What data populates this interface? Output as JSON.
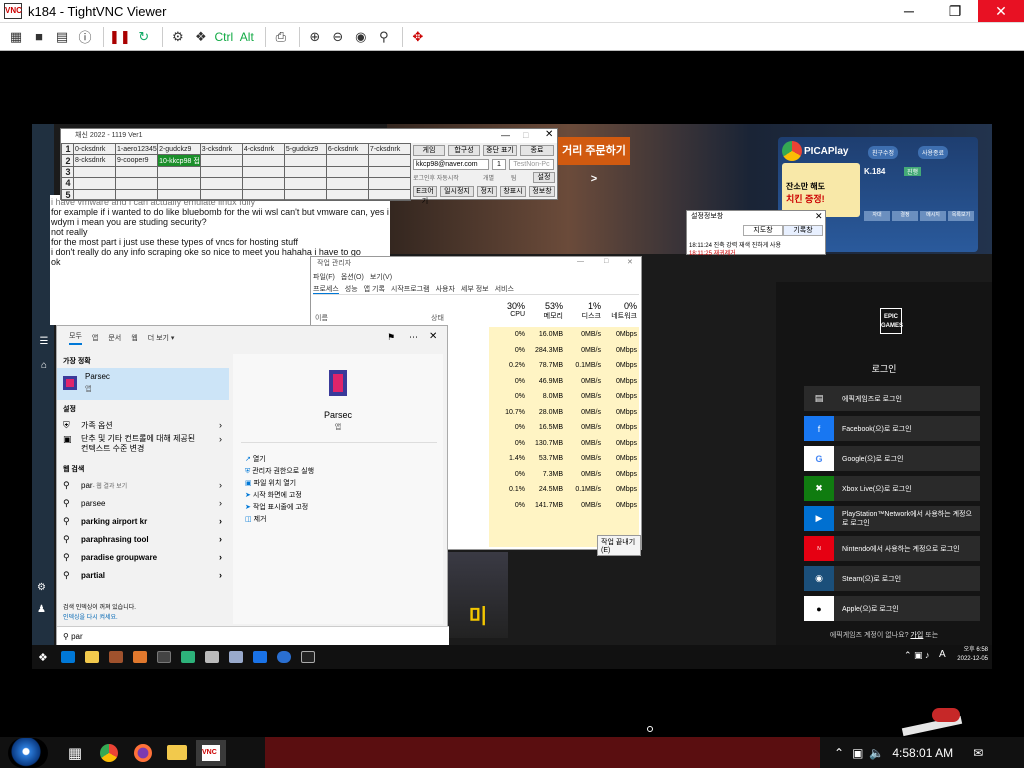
{
  "window": {
    "title": "k184 - TightVNC Viewer",
    "icon": "VNC",
    "controls": [
      "minimize-icon",
      "maximize-icon",
      "close-icon"
    ]
  },
  "toolbar": {
    "ctrl": "Ctrl",
    "alt": "Alt"
  },
  "remote": {
    "game_window": {
      "title": "채신 2022 - 1119 Ver1",
      "rows": [
        "1",
        "2",
        "3",
        "4",
        "5"
      ],
      "row1": [
        "0-cksdnrk",
        "1-aero12345",
        "2-gudckz9",
        "3-cksdnrk",
        "4-cksdnrk",
        "5-gudckz9",
        "6-cksdnrk",
        "7-cksdnrk"
      ],
      "row2": [
        "8-cksdnrk",
        "9-cooper9",
        "10-kkcp98"
      ],
      "row2_sub": "접",
      "buttons": [
        "게임",
        "합구성",
        "중단 표기",
        "종료"
      ],
      "email": "kkcp98@naver.com",
      "pass": "1",
      "mode": "TestNon-Pc",
      "check1": "로그인후 자동시작",
      "check2": "개별",
      "check3": "팀",
      "set": "설정",
      "bottom_buttons": [
        "E크어기",
        "일시정지",
        "정지",
        "창표시",
        "정보창"
      ]
    },
    "chat": [
      "i have vmware and i can actually emulate linux fully",
      "for example if i wanted to do like bluebomb for the wii wsl can't but vmware can, yes i",
      "wdym i mean you are studing security?",
      "not really",
      "for the most part i just use these types of vncs for hosting stuff",
      "i don't really do any info scraping oke so nice to meet you hahaha i have to go",
      "ok"
    ],
    "banner": "거리 주문하기 >",
    "picaplay": {
      "brand": "PICAPlay",
      "btn1": "친구수정",
      "btn2": "사용종료",
      "id": "K.184",
      "status": "진행",
      "promo1": "잔소만 해도",
      "promo2": "치킨 증정!",
      "tabs": [
        "자대",
        "결정",
        "메시지",
        "목록보기"
      ]
    },
    "dialog": {
      "title": "설정정보창",
      "tab1": "지도창",
      "tab2": "기록창",
      "line1": "18:11:24 진축 강력 재색 진하게 사용",
      "line2": "18:11:25 재귀제거"
    },
    "taskmgr": {
      "title": "작업 관리자",
      "menu": [
        "파일(F)",
        "옵션(O)",
        "보기(V)"
      ],
      "tabs": [
        "프로세스",
        "성능",
        "앱 기록",
        "시작프로그램",
        "사용자",
        "세부 정보",
        "서비스"
      ],
      "col_name": "이름",
      "col_status": "상태",
      "cpu_pct": "30%",
      "cpu": "CPU",
      "mem_pct": "53%",
      "mem": "메모리",
      "disk_pct": "1%",
      "disk": "디스크",
      "net_pct": "0%",
      "net": "네트워크",
      "cpu_vals": [
        "0%",
        "0%",
        "0.2%",
        "0%",
        "0%",
        "10.7%",
        "0%",
        "0%",
        "1.4%",
        "0%",
        "0.1%",
        "0%"
      ],
      "mem_vals": [
        "16.0MB",
        "284.3MB",
        "78.7MB",
        "46.9MB",
        "8.0MB",
        "28.0MB",
        "16.5MB",
        "130.7MB",
        "53.7MB",
        "7.3MB",
        "24.5MB",
        "141.7MB"
      ],
      "disk_vals": [
        "0MB/s",
        "0MB/s",
        "0.1MB/s",
        "0MB/s",
        "0MB/s",
        "0MB/s",
        "0MB/s",
        "0MB/s",
        "0MB/s",
        "0MB/s",
        "0.1MB/s",
        "0MB/s"
      ],
      "net_vals": [
        "0Mbps",
        "0Mbps",
        "0Mbps",
        "0Mbps",
        "0Mbps",
        "0Mbps",
        "0Mbps",
        "0Mbps",
        "0Mbps",
        "0Mbps",
        "0Mbps",
        "0Mbps"
      ],
      "end_task": "작업 끝내기(E)"
    },
    "start": {
      "tabs": [
        "모두",
        "앱",
        "문서",
        "웹",
        "더 보기"
      ],
      "best_match": "가장 정확",
      "top_app": "Parsec",
      "top_app_type": "앱",
      "settings_header": "설정",
      "settings": [
        "가족 옵션",
        "단추 및 기타 컨트롤에 대해 제공된",
        "컨텍스트 수준 변경"
      ],
      "web_header": "웹 검색",
      "web": [
        "par",
        "parsee",
        "parking airport kr",
        "paraphrasing tool",
        "paradise groupware",
        "partial"
      ],
      "web_first_hint": " - 웹 결과 보기",
      "notice1": "검색 인덱싱이 꺼져 있습니다.",
      "notice2": "인덱싱을 다시 켜세요.",
      "right_title": "Parsec",
      "right_type": "앱",
      "actions": [
        "열기",
        "관리자 권한으로 실행",
        "파일 위치 열기",
        "시작 화면에 고정",
        "작업 표시줄에 고정",
        "제거"
      ],
      "query": "par"
    },
    "epic": {
      "logo": "EPIC GAMES",
      "heading": "로그인",
      "buttons": [
        "에픽게임즈로 로그인",
        "Facebook(으)로 로그인",
        "Google(으)로 로그인",
        "Xbox Live(으)로 로그인",
        "PlayStation™Network에서 사용하는 계정으로 로그인",
        "Nintendo에서 사용하는 계정으로 로그인",
        "Steam(으)로 로그인",
        "Apple(으)로 로그인"
      ],
      "footer": "에픽게임즈 계정이 없나요?",
      "signup": "가입",
      "footer2": "또는"
    },
    "rtray": {
      "lang": "A",
      "time": "오후 6:58",
      "date": "2022-12-05"
    },
    "movie_title": "미"
  },
  "host": {
    "time": "4:58:01 AM"
  },
  "colors": {
    "accent_blue": "#0078d7",
    "tm_yellow": "#fff4c4",
    "game_green": "#1b8f2a"
  }
}
